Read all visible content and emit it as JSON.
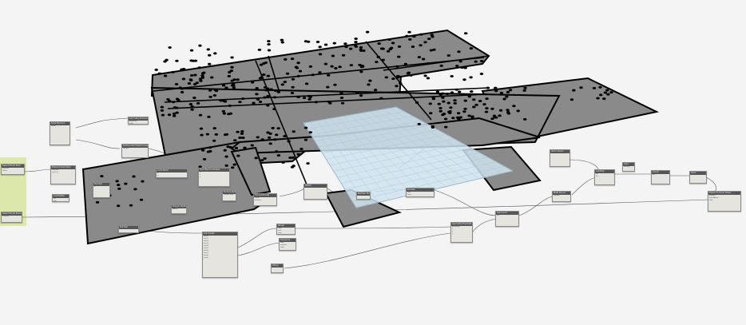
{
  "canvas": {
    "background": "#f4f4f4"
  },
  "group": {
    "color": "#d9e6a6"
  },
  "colors": {
    "plot_fill": "#8a8a8a",
    "plot_stroke": "#000000",
    "surface_fill": "#cfe3ee",
    "node_fill": "#e6e4de",
    "node_header": "#555555",
    "wire": "#555555"
  },
  "nodes": [
    {
      "id": "n1",
      "title": "Select Model Elem",
      "ports": [
        "Element",
        "Select"
      ]
    },
    {
      "id": "n2",
      "title": "Element.Geometry",
      "ports": [
        "element",
        "var[]..[]"
      ]
    },
    {
      "id": "n3",
      "title": "List.Flatten",
      "ports": [
        "list",
        "amt"
      ]
    },
    {
      "id": "n4",
      "title": "Solid.ByUnion",
      "ports": [
        "solids"
      ]
    },
    {
      "id": "n5",
      "title": "Geometry.Intersect",
      "ports": [
        "geometry",
        "other"
      ]
    },
    {
      "id": "n6",
      "title": "Surface.PerimeterCurves",
      "ports": [
        "surface"
      ]
    },
    {
      "id": "n7",
      "title": "Number",
      "ports": [
        "0"
      ]
    },
    {
      "id": "n8",
      "title": "Code Block",
      "ports": [
        "x;",
        "y;",
        "z;"
      ]
    },
    {
      "id": "n9",
      "title": "Point.ByCoordinates",
      "ports": [
        "x",
        "y",
        "z"
      ]
    },
    {
      "id": "n10",
      "title": "Polygon.ByPoints",
      "ports": [
        "points"
      ]
    },
    {
      "id": "n11",
      "title": "Surface.ByPatch",
      "ports": [
        "closedCurve"
      ]
    },
    {
      "id": "n12",
      "title": "Curve.Extrude",
      "ports": [
        "curve",
        "distance"
      ]
    },
    {
      "id": "n13",
      "title": "Watch",
      "ports": []
    },
    {
      "id": "n14",
      "title": "Number Slider",
      "ports": []
    },
    {
      "id": "n15",
      "title": "Boolean",
      "ports": [
        "True",
        "False"
      ]
    },
    {
      "id": "n16",
      "title": "List.Create",
      "ports": [
        "item0",
        "item1",
        "item2",
        "item3",
        "item4",
        "item5",
        "item6",
        "item7",
        "item8",
        "item9"
      ]
    },
    {
      "id": "n17",
      "title": "Range",
      "ports": [
        "start",
        "end",
        "step"
      ]
    },
    {
      "id": "n18",
      "title": "Sequence",
      "ports": [
        "start",
        "amount",
        "step"
      ]
    },
    {
      "id": "n19",
      "title": "String",
      "ports": []
    },
    {
      "id": "n20",
      "title": "Geometry.Translate",
      "ports": [
        "geometry",
        "x",
        "y",
        "z"
      ]
    },
    {
      "id": "n21",
      "title": "List.Count",
      "ports": [
        "list"
      ]
    },
    {
      "id": "n22",
      "title": "Math.Round",
      "ports": [
        "number"
      ]
    },
    {
      "id": "n23",
      "title": "Vector.ZAxis",
      "ports": []
    },
    {
      "id": "n24",
      "title": "List.Map",
      "ports": [
        "list",
        "f(x)"
      ]
    },
    {
      "id": "n25",
      "title": "Area",
      "ports": [
        "surface"
      ]
    },
    {
      "id": "n26",
      "title": "Count",
      "ports": [
        "list"
      ]
    },
    {
      "id": "n27",
      "title": "Export To Excel Sheet",
      "ports": [
        "filePath",
        "sheetName",
        "data"
      ]
    },
    {
      "id": "n28",
      "title": "Point",
      "ports": []
    },
    {
      "id": "n29",
      "title": "Number",
      "ports": []
    },
    {
      "id": "n30",
      "title": "Select Model Element",
      "ports": [
        "Element"
      ]
    }
  ]
}
